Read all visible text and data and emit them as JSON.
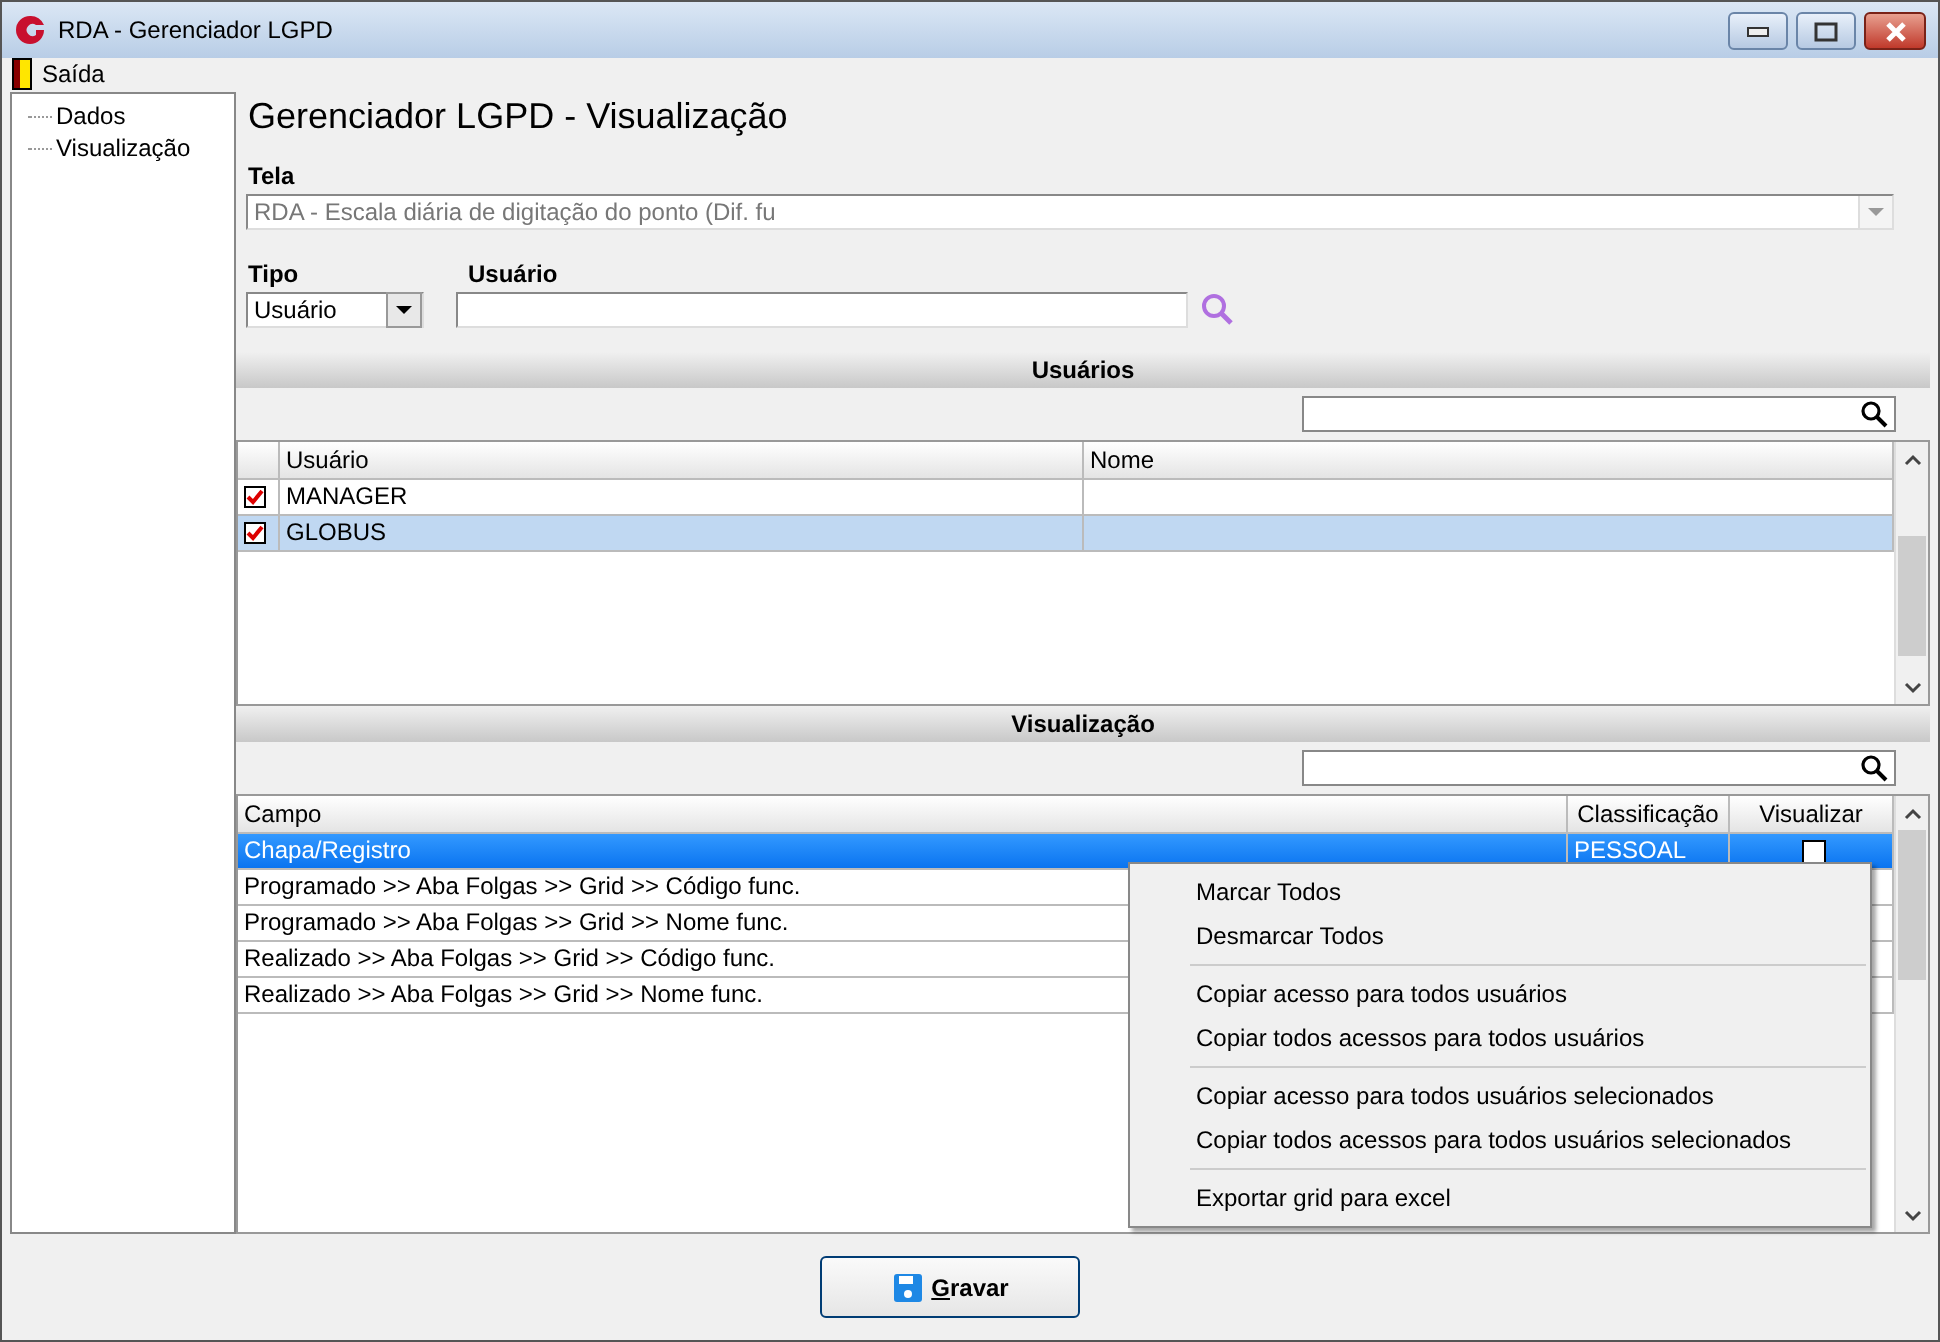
{
  "window": {
    "title": "RDA - Gerenciador LGPD"
  },
  "menu_bar": [
    {
      "label": "Saída"
    }
  ],
  "tree": {
    "items": [
      {
        "label": "Dados"
      },
      {
        "label": "Visualização"
      }
    ]
  },
  "heading": "Gerenciador LGPD - Visualização",
  "tela": {
    "label": "Tela",
    "value": "RDA - Escala diária de digitação do ponto (Dif. fu",
    "disabled": true
  },
  "tipo": {
    "label": "Tipo",
    "value": "Usuário"
  },
  "usuario": {
    "label": "Usuário"
  },
  "usuarios": {
    "title": "Usuários",
    "columns": [
      "Usuário",
      "Nome"
    ],
    "rows": [
      {
        "checked": true,
        "usuario": "MANAGER",
        "selected": false
      },
      {
        "checked": true,
        "usuario": "GLOBUS",
        "selected": true
      }
    ]
  },
  "visualizacao": {
    "title": "Visualização",
    "columns": [
      "Campo",
      "Classificação",
      "Visualizar"
    ],
    "rows": [
      {
        "campo": "Chapa/Registro",
        "classificacao": "PESSOAL",
        "visualizar": false,
        "selected": true
      },
      {
        "campo": "Programado >> Aba Folgas >> Grid >> Código func.",
        "selected": false
      },
      {
        "campo": "Programado >> Aba Folgas >> Grid >> Nome func.",
        "selected": false
      },
      {
        "campo": "Realizado >> Aba Folgas >> Grid >> Código func.",
        "selected": false
      },
      {
        "campo": "Realizado >> Aba Folgas >> Grid >> Nome func.",
        "selected": false
      }
    ]
  },
  "context_menu": {
    "groups": [
      [
        "Marcar Todos",
        "Desmarcar Todos"
      ],
      [
        "Copiar acesso para todos usuários",
        "Copiar todos acessos para todos usuários"
      ],
      [
        "Copiar acesso para todos usuários selecionados",
        "Copiar todos acessos para todos usuários selecionados"
      ],
      [
        "Exportar grid para excel"
      ]
    ]
  },
  "save_button": {
    "label": "Gravar"
  }
}
